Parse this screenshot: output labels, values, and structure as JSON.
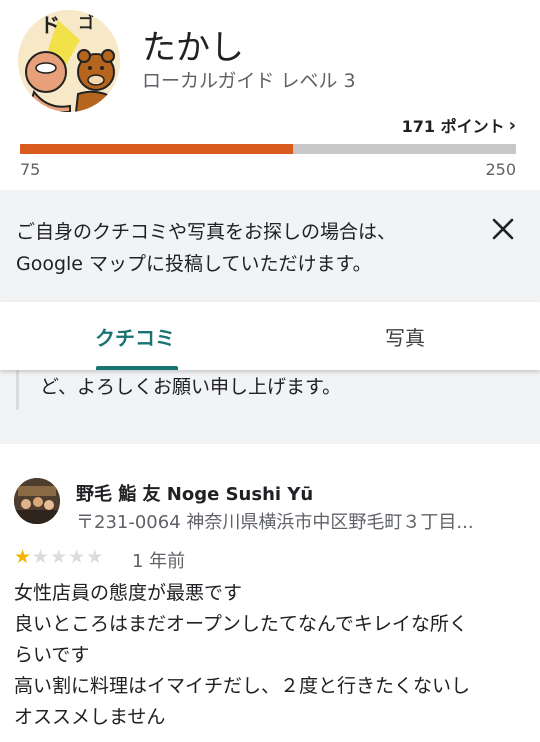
{
  "profile": {
    "name": "たかし",
    "level": "ローカルガイド レベル 3",
    "points_label": "171 ポイント",
    "points": 171,
    "bar_min": "75",
    "bar_max": "250",
    "progress_fraction": 0.55,
    "avatar_icon": "manga-avatar",
    "colors": {
      "progress": "#d85a1c",
      "track": "#c7c7c7"
    }
  },
  "banner": {
    "lines": [
      "ご自身のクチコミや写真をお探しの場合は、",
      "Google マップに投稿していただけます。"
    ],
    "close_icon": "close-icon"
  },
  "tabs": [
    {
      "label": "クチコミ",
      "selected": true
    },
    {
      "label": "写真",
      "selected": false
    }
  ],
  "tab_accent": "#1a7373",
  "previous_review": {
    "text": "ど、よろしくお願い申し上げます。"
  },
  "review": {
    "place_name": "野毛 鮨 友 Noge Sushi Yū",
    "address": "〒231-0064 神奈川県横浜市中区野毛町３丁目...",
    "rating": 1,
    "max_rating": 5,
    "date": "1 年前",
    "lines": [
      "女性店員の態度が最悪です",
      "良いところはまだオープンしたてなんでキレイな所く",
      "らいです",
      "高い割に料理はイマイチだし、２度と行きたくないし",
      "オススメしません"
    ]
  }
}
